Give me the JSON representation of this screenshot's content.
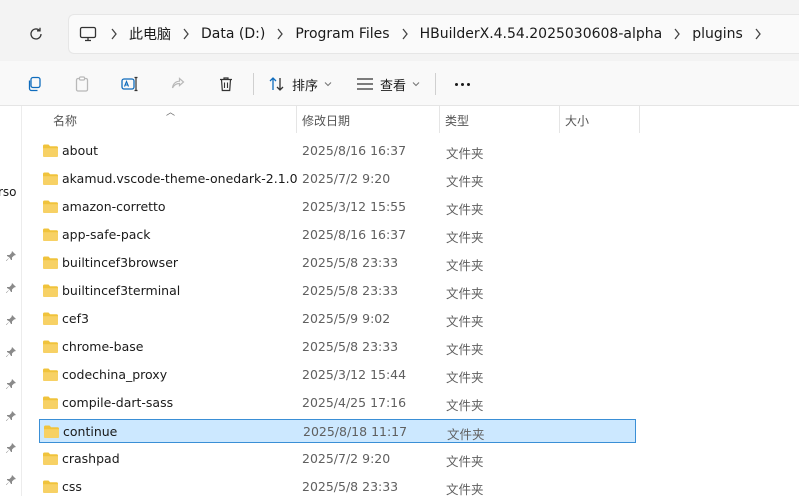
{
  "breadcrumb": {
    "items": [
      "此电脑",
      "Data (D:)",
      "Program Files",
      "HBuilderX.4.54.2025030608-alpha",
      "plugins"
    ]
  },
  "commandbar": {
    "sort_label": "排序",
    "view_label": "查看"
  },
  "nav": {
    "partial_text": "rso"
  },
  "columns": {
    "name": "名称",
    "modified": "修改日期",
    "type": "类型",
    "size": "大小"
  },
  "files": [
    {
      "name": "about",
      "modified": "2025/8/16 16:37",
      "type": "文件夹",
      "size": ""
    },
    {
      "name": "akamud.vscode-theme-onedark-2.1.0",
      "modified": "2025/7/2 9:20",
      "type": "文件夹",
      "size": ""
    },
    {
      "name": "amazon-corretto",
      "modified": "2025/3/12 15:55",
      "type": "文件夹",
      "size": ""
    },
    {
      "name": "app-safe-pack",
      "modified": "2025/8/16 16:37",
      "type": "文件夹",
      "size": ""
    },
    {
      "name": "builtincef3browser",
      "modified": "2025/5/8 23:33",
      "type": "文件夹",
      "size": ""
    },
    {
      "name": "builtincef3terminal",
      "modified": "2025/5/8 23:33",
      "type": "文件夹",
      "size": ""
    },
    {
      "name": "cef3",
      "modified": "2025/5/9 9:02",
      "type": "文件夹",
      "size": ""
    },
    {
      "name": "chrome-base",
      "modified": "2025/5/8 23:33",
      "type": "文件夹",
      "size": ""
    },
    {
      "name": "codechina_proxy",
      "modified": "2025/3/12 15:44",
      "type": "文件夹",
      "size": ""
    },
    {
      "name": "compile-dart-sass",
      "modified": "2025/4/25 17:16",
      "type": "文件夹",
      "size": ""
    },
    {
      "name": "continue",
      "modified": "2025/8/18 11:17",
      "type": "文件夹",
      "size": "",
      "selected": true
    },
    {
      "name": "crashpad",
      "modified": "2025/7/2 9:20",
      "type": "文件夹",
      "size": ""
    },
    {
      "name": "css",
      "modified": "2025/5/8 23:33",
      "type": "文件夹",
      "size": ""
    }
  ],
  "colors": {
    "folder": "#f0c33c",
    "selection_bg": "#cce8ff",
    "selection_border": "#3a8fd6"
  }
}
